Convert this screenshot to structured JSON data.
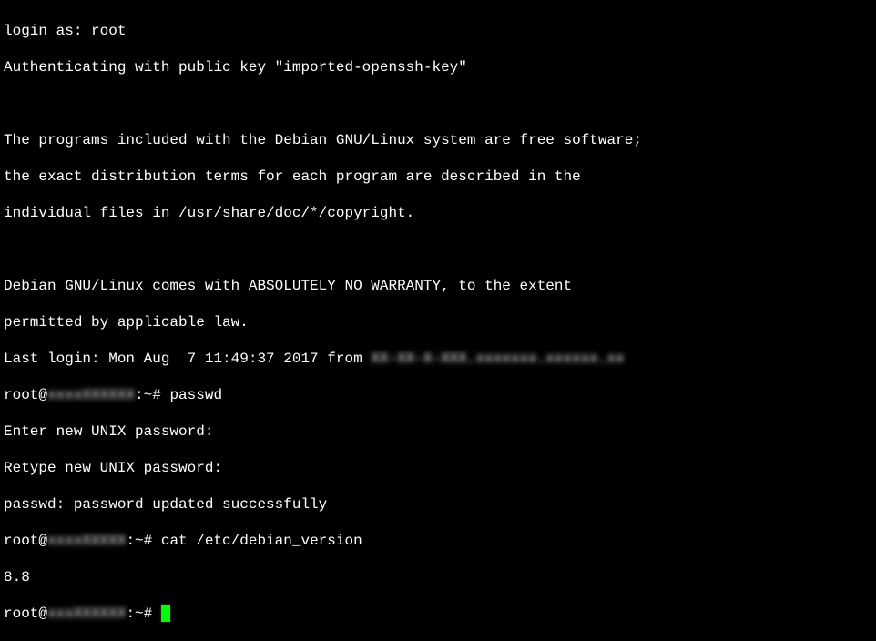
{
  "terminal": {
    "lines": {
      "login_prompt": "login as: root",
      "auth_line": "Authenticating with public key \"imported-openssh-key\"",
      "blank1": " ",
      "motd1": "The programs included with the Debian GNU/Linux system are free software;",
      "motd2": "the exact distribution terms for each program are described in the",
      "motd3": "individual files in /usr/share/doc/*/copyright.",
      "blank2": " ",
      "motd4": "Debian GNU/Linux comes with ABSOLUTELY NO WARRANTY, to the extent",
      "motd5": "permitted by applicable law.",
      "last_login_prefix": "Last login: Mon Aug  7 11:49:37 2017 from ",
      "last_login_host": "XX-XX-X-XXX.xxxxxxx.xxxxxx.xx",
      "prompt1_user": "root@",
      "prompt1_host": "xxxxXXXXXX",
      "prompt1_path": ":~# ",
      "prompt1_cmd": "passwd",
      "passwd1": "Enter new UNIX password:",
      "passwd2": "Retype new UNIX password:",
      "passwd3": "passwd: password updated successfully",
      "prompt2_user": "root@",
      "prompt2_host": "xxxxXXXXX",
      "prompt2_path": ":~# ",
      "prompt2_cmd": "cat /etc/debian_version",
      "version": "8.8",
      "prompt3_user": "root@",
      "prompt3_host": "xxxXXXXXX",
      "prompt3_path": ":~# "
    }
  }
}
